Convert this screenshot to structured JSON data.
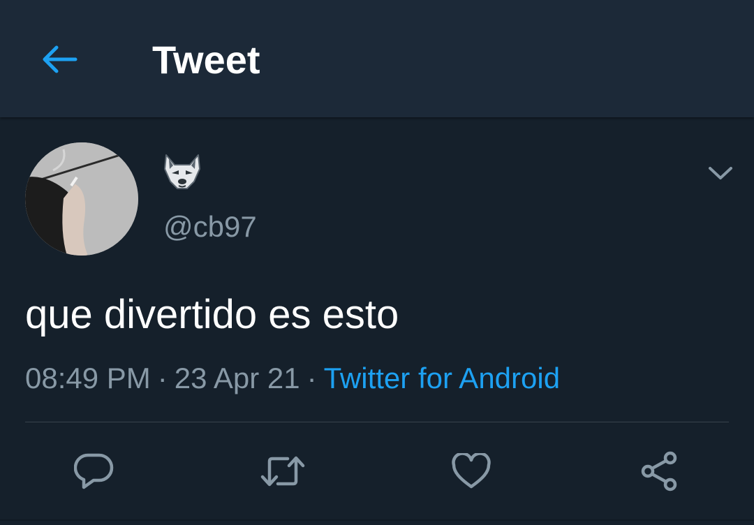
{
  "header": {
    "title": "Tweet",
    "back_icon": "arrow-left-icon",
    "accent": "#1da1f2"
  },
  "tweet": {
    "display_name_icon": "wolf-face-emoji",
    "handle": "@cb97",
    "text": "que divertido es esto",
    "time": "08:49 PM",
    "separator": "·",
    "date": "23 Apr 21",
    "source": "Twitter for Android",
    "menu_icon": "chevron-down-icon"
  },
  "actions": [
    {
      "icon": "reply-icon"
    },
    {
      "icon": "retweet-icon"
    },
    {
      "icon": "heart-icon"
    },
    {
      "icon": "share-icon"
    }
  ],
  "colors": {
    "background": "#15202b",
    "header_background": "#1c2938",
    "secondary_text": "#8899a6",
    "link": "#1da1f2",
    "divider": "#38444d"
  }
}
